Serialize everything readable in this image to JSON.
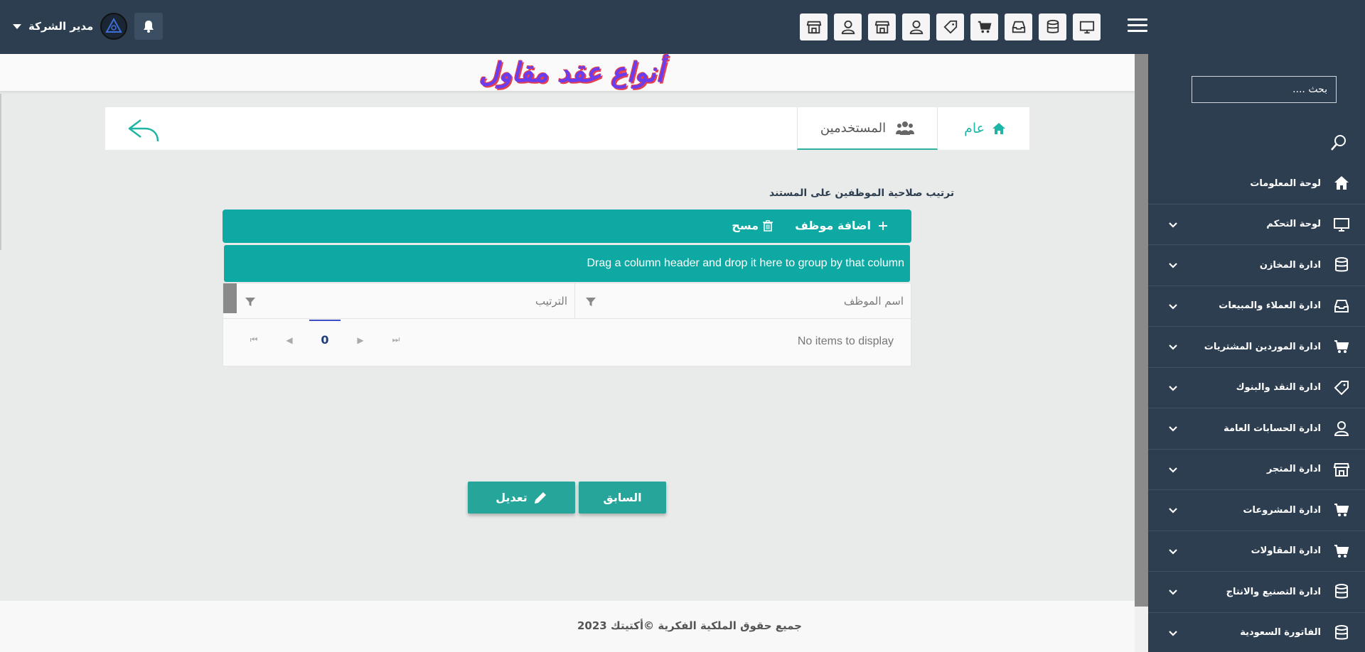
{
  "page": {
    "title": "أنواع عقد مقاول"
  },
  "header": {
    "user_name": "مدير الشركة",
    "toolbar_icons": [
      "monitor-icon",
      "database-icon",
      "inbox-icon",
      "cart-icon",
      "tag-icon",
      "user-icon",
      "store-icon",
      "user-icon",
      "store-icon"
    ]
  },
  "sidebar": {
    "search_placeholder": "بحث ....",
    "items": [
      {
        "label": "لوحة المعلومات",
        "icon": "home-icon",
        "has_submenu": false
      },
      {
        "label": "لوحة التحكم",
        "icon": "monitor-icon",
        "has_submenu": true
      },
      {
        "label": "ادارة المخازن",
        "icon": "database-icon",
        "has_submenu": true
      },
      {
        "label": "ادارة العملاء والمبيعات",
        "icon": "inbox-icon",
        "has_submenu": true
      },
      {
        "label": "ادارة الموردين المشتريات",
        "icon": "cart-icon",
        "has_submenu": true
      },
      {
        "label": "ادارة النقد والبنوك",
        "icon": "tag-icon",
        "has_submenu": true
      },
      {
        "label": "ادارة الحسابات العامة",
        "icon": "user-icon",
        "has_submenu": true
      },
      {
        "label": "ادارة المتجر",
        "icon": "store-icon",
        "has_submenu": true
      },
      {
        "label": "ادارة المشروعات",
        "icon": "cart-icon",
        "has_submenu": true
      },
      {
        "label": "ادارة المقاولات",
        "icon": "cart-icon",
        "has_submenu": true
      },
      {
        "label": "ادارة التصنيع والانتاج",
        "icon": "database-icon",
        "has_submenu": true
      },
      {
        "label": "الفاتورة السعودية",
        "icon": "database-icon",
        "has_submenu": true
      }
    ]
  },
  "tabs": {
    "home": "عام",
    "users": "المستخدمين"
  },
  "section": {
    "label": "ترتيب صلاحية الموظفين على المستند"
  },
  "grid": {
    "add_label": "اضافة موظف",
    "delete_label": "مسح",
    "group_hint": "Drag a column header and drop it here to group by that column",
    "columns": [
      "اسم الموظف",
      "الترتيب"
    ],
    "empty_text": "No items to display",
    "current_page": "0"
  },
  "actions": {
    "previous": "السابق",
    "edit": "تعديل"
  },
  "footer": {
    "copyright": "جميع حقوق الملكية الفكرية ©أكتيتك 2023"
  },
  "colors": {
    "header_bg": "#2d3e50",
    "accent_teal": "#0fa9a3",
    "button_teal": "#26a69a",
    "title_purple": "#6a3df0",
    "title_shadow_red": "#e5404d"
  }
}
